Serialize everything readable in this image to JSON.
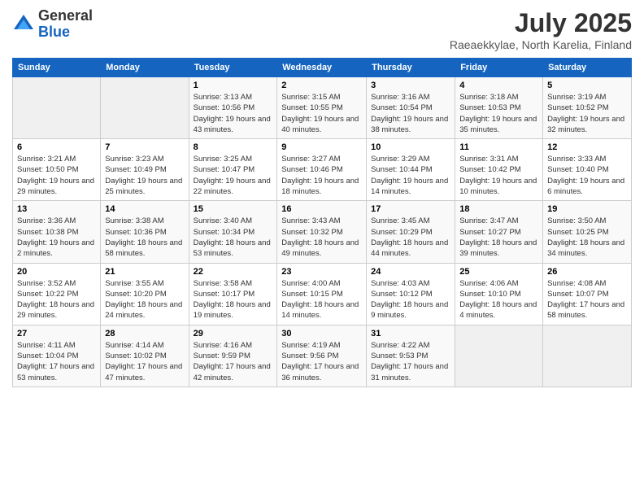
{
  "header": {
    "logo_general": "General",
    "logo_blue": "Blue",
    "month_year": "July 2025",
    "location": "Raeaekkylae, North Karelia, Finland"
  },
  "days_of_week": [
    "Sunday",
    "Monday",
    "Tuesday",
    "Wednesday",
    "Thursday",
    "Friday",
    "Saturday"
  ],
  "weeks": [
    [
      {
        "day": "",
        "empty": true
      },
      {
        "day": "",
        "empty": true
      },
      {
        "day": "1",
        "sunrise": "Sunrise: 3:13 AM",
        "sunset": "Sunset: 10:56 PM",
        "daylight": "Daylight: 19 hours and 43 minutes."
      },
      {
        "day": "2",
        "sunrise": "Sunrise: 3:15 AM",
        "sunset": "Sunset: 10:55 PM",
        "daylight": "Daylight: 19 hours and 40 minutes."
      },
      {
        "day": "3",
        "sunrise": "Sunrise: 3:16 AM",
        "sunset": "Sunset: 10:54 PM",
        "daylight": "Daylight: 19 hours and 38 minutes."
      },
      {
        "day": "4",
        "sunrise": "Sunrise: 3:18 AM",
        "sunset": "Sunset: 10:53 PM",
        "daylight": "Daylight: 19 hours and 35 minutes."
      },
      {
        "day": "5",
        "sunrise": "Sunrise: 3:19 AM",
        "sunset": "Sunset: 10:52 PM",
        "daylight": "Daylight: 19 hours and 32 minutes."
      }
    ],
    [
      {
        "day": "6",
        "sunrise": "Sunrise: 3:21 AM",
        "sunset": "Sunset: 10:50 PM",
        "daylight": "Daylight: 19 hours and 29 minutes."
      },
      {
        "day": "7",
        "sunrise": "Sunrise: 3:23 AM",
        "sunset": "Sunset: 10:49 PM",
        "daylight": "Daylight: 19 hours and 25 minutes."
      },
      {
        "day": "8",
        "sunrise": "Sunrise: 3:25 AM",
        "sunset": "Sunset: 10:47 PM",
        "daylight": "Daylight: 19 hours and 22 minutes."
      },
      {
        "day": "9",
        "sunrise": "Sunrise: 3:27 AM",
        "sunset": "Sunset: 10:46 PM",
        "daylight": "Daylight: 19 hours and 18 minutes."
      },
      {
        "day": "10",
        "sunrise": "Sunrise: 3:29 AM",
        "sunset": "Sunset: 10:44 PM",
        "daylight": "Daylight: 19 hours and 14 minutes."
      },
      {
        "day": "11",
        "sunrise": "Sunrise: 3:31 AM",
        "sunset": "Sunset: 10:42 PM",
        "daylight": "Daylight: 19 hours and 10 minutes."
      },
      {
        "day": "12",
        "sunrise": "Sunrise: 3:33 AM",
        "sunset": "Sunset: 10:40 PM",
        "daylight": "Daylight: 19 hours and 6 minutes."
      }
    ],
    [
      {
        "day": "13",
        "sunrise": "Sunrise: 3:36 AM",
        "sunset": "Sunset: 10:38 PM",
        "daylight": "Daylight: 19 hours and 2 minutes."
      },
      {
        "day": "14",
        "sunrise": "Sunrise: 3:38 AM",
        "sunset": "Sunset: 10:36 PM",
        "daylight": "Daylight: 18 hours and 58 minutes."
      },
      {
        "day": "15",
        "sunrise": "Sunrise: 3:40 AM",
        "sunset": "Sunset: 10:34 PM",
        "daylight": "Daylight: 18 hours and 53 minutes."
      },
      {
        "day": "16",
        "sunrise": "Sunrise: 3:43 AM",
        "sunset": "Sunset: 10:32 PM",
        "daylight": "Daylight: 18 hours and 49 minutes."
      },
      {
        "day": "17",
        "sunrise": "Sunrise: 3:45 AM",
        "sunset": "Sunset: 10:29 PM",
        "daylight": "Daylight: 18 hours and 44 minutes."
      },
      {
        "day": "18",
        "sunrise": "Sunrise: 3:47 AM",
        "sunset": "Sunset: 10:27 PM",
        "daylight": "Daylight: 18 hours and 39 minutes."
      },
      {
        "day": "19",
        "sunrise": "Sunrise: 3:50 AM",
        "sunset": "Sunset: 10:25 PM",
        "daylight": "Daylight: 18 hours and 34 minutes."
      }
    ],
    [
      {
        "day": "20",
        "sunrise": "Sunrise: 3:52 AM",
        "sunset": "Sunset: 10:22 PM",
        "daylight": "Daylight: 18 hours and 29 minutes."
      },
      {
        "day": "21",
        "sunrise": "Sunrise: 3:55 AM",
        "sunset": "Sunset: 10:20 PM",
        "daylight": "Daylight: 18 hours and 24 minutes."
      },
      {
        "day": "22",
        "sunrise": "Sunrise: 3:58 AM",
        "sunset": "Sunset: 10:17 PM",
        "daylight": "Daylight: 18 hours and 19 minutes."
      },
      {
        "day": "23",
        "sunrise": "Sunrise: 4:00 AM",
        "sunset": "Sunset: 10:15 PM",
        "daylight": "Daylight: 18 hours and 14 minutes."
      },
      {
        "day": "24",
        "sunrise": "Sunrise: 4:03 AM",
        "sunset": "Sunset: 10:12 PM",
        "daylight": "Daylight: 18 hours and 9 minutes."
      },
      {
        "day": "25",
        "sunrise": "Sunrise: 4:06 AM",
        "sunset": "Sunset: 10:10 PM",
        "daylight": "Daylight: 18 hours and 4 minutes."
      },
      {
        "day": "26",
        "sunrise": "Sunrise: 4:08 AM",
        "sunset": "Sunset: 10:07 PM",
        "daylight": "Daylight: 17 hours and 58 minutes."
      }
    ],
    [
      {
        "day": "27",
        "sunrise": "Sunrise: 4:11 AM",
        "sunset": "Sunset: 10:04 PM",
        "daylight": "Daylight: 17 hours and 53 minutes."
      },
      {
        "day": "28",
        "sunrise": "Sunrise: 4:14 AM",
        "sunset": "Sunset: 10:02 PM",
        "daylight": "Daylight: 17 hours and 47 minutes."
      },
      {
        "day": "29",
        "sunrise": "Sunrise: 4:16 AM",
        "sunset": "Sunset: 9:59 PM",
        "daylight": "Daylight: 17 hours and 42 minutes."
      },
      {
        "day": "30",
        "sunrise": "Sunrise: 4:19 AM",
        "sunset": "Sunset: 9:56 PM",
        "daylight": "Daylight: 17 hours and 36 minutes."
      },
      {
        "day": "31",
        "sunrise": "Sunrise: 4:22 AM",
        "sunset": "Sunset: 9:53 PM",
        "daylight": "Daylight: 17 hours and 31 minutes."
      },
      {
        "day": "",
        "empty": true
      },
      {
        "day": "",
        "empty": true
      }
    ]
  ]
}
